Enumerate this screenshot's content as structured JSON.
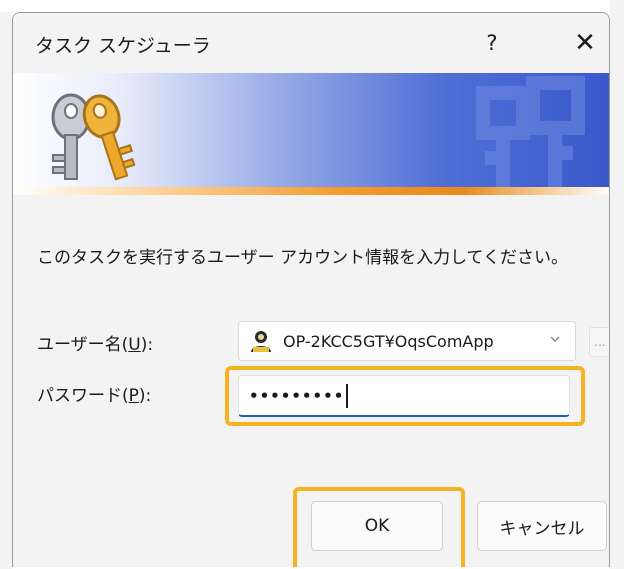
{
  "window": {
    "title": "タスク スケジューラ",
    "help_label": "?",
    "close_label": "✕"
  },
  "banner": {
    "icon": "keys-icon",
    "colors": {
      "gradient_end": "#3959cc",
      "stripe": "#f39b2c"
    }
  },
  "prompt": {
    "text": "このタスクを実行するユーザー アカウント情報を入力してください。"
  },
  "user": {
    "label_prefix": "ユーザー名(",
    "label_key": "U",
    "label_suffix": "):",
    "value": "OP-2KCC5GT¥OqsComApp",
    "icon": "user-avatar-icon",
    "browse_label": "..."
  },
  "password": {
    "label_prefix": "パスワード(",
    "label_key": "P",
    "label_suffix": "):",
    "value": "•••••••••"
  },
  "buttons": {
    "ok_label": "OK",
    "cancel_label": "キャンセル"
  },
  "colors": {
    "highlight": "#f7b224",
    "focus_underline": "#1f5fbd"
  }
}
